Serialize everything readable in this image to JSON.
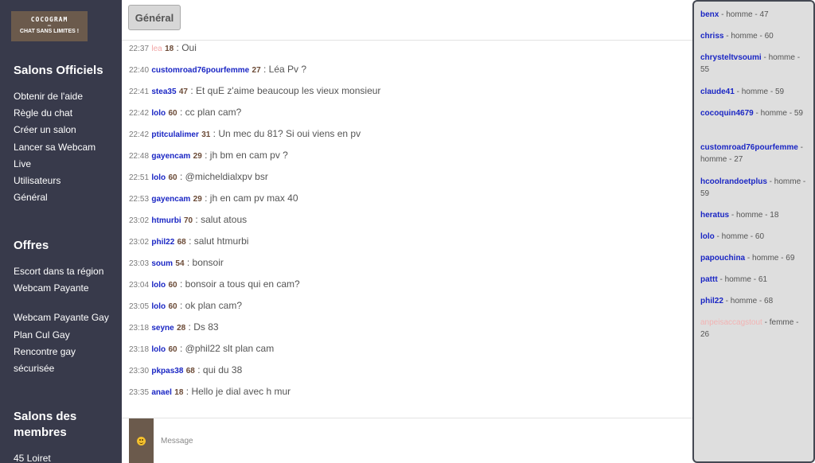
{
  "logo": {
    "line1": "COCOGRAM",
    "line2": "–",
    "line3": "CHAT SANS LIMITES !"
  },
  "sidebar": {
    "sections": [
      {
        "title": "Salons Officiels",
        "items": [
          "Obtenir de l'aide",
          "Règle du chat",
          "Créer un salon",
          "Lancer sa Webcam",
          "Live",
          "Utilisateurs",
          "Général"
        ]
      },
      {
        "title": "Offres",
        "items": [
          "Escort dans ta région",
          "Webcam Payante",
          "Webcam Payante Gay",
          "Plan Cul Gay",
          "Rencontre gay",
          "sécurisée"
        ]
      },
      {
        "title_line1": "Salons des",
        "title_line2": "membres",
        "items": [
          "45 Loiret"
        ]
      }
    ]
  },
  "topbar": {
    "active_tab": "Général"
  },
  "messages": [
    {
      "time": "22:37",
      "user": "lea",
      "age": "18",
      "text": "Oui",
      "gender": "female"
    },
    {
      "time": "22:40",
      "user": "customroad76pourfemme",
      "age": "27",
      "text": "Léa Pv ?",
      "gender": "male"
    },
    {
      "time": "22:41",
      "user": "stea35",
      "age": "47",
      "text": "Et quE z'aime beaucoup les vieux monsieur",
      "gender": "male"
    },
    {
      "time": "22:42",
      "user": "lolo",
      "age": "60",
      "text": "cc plan cam?",
      "gender": "male"
    },
    {
      "time": "22:42",
      "user": "ptitculalimer",
      "age": "31",
      "text": "Un mec du 81? Si oui viens en pv",
      "gender": "male"
    },
    {
      "time": "22:48",
      "user": "gayencam",
      "age": "29",
      "text": "jh bm en cam pv ?",
      "gender": "male"
    },
    {
      "time": "22:51",
      "user": "lolo",
      "age": "60",
      "text": "@micheldialxpv bsr",
      "gender": "male"
    },
    {
      "time": "22:53",
      "user": "gayencam",
      "age": "29",
      "text": "jh en cam pv max 40",
      "gender": "male"
    },
    {
      "time": "23:02",
      "user": "htmurbi",
      "age": "70",
      "text": "salut atous",
      "gender": "male"
    },
    {
      "time": "23:02",
      "user": "phil22",
      "age": "68",
      "text": "salut htmurbi",
      "gender": "male"
    },
    {
      "time": "23:03",
      "user": "soum",
      "age": "54",
      "text": "bonsoir",
      "gender": "male"
    },
    {
      "time": "23:04",
      "user": "lolo",
      "age": "60",
      "text": "bonsoir a tous qui en cam?",
      "gender": "male"
    },
    {
      "time": "23:05",
      "user": "lolo",
      "age": "60",
      "text": "ok plan cam?",
      "gender": "male"
    },
    {
      "time": "23:18",
      "user": "seyne",
      "age": "28",
      "text": "Ds 83",
      "gender": "male"
    },
    {
      "time": "23:18",
      "user": "lolo",
      "age": "60",
      "text": "@phil22 slt plan cam",
      "gender": "male"
    },
    {
      "time": "23:30",
      "user": "pkpas38",
      "age": "68",
      "text": "qui du 38",
      "gender": "male"
    },
    {
      "time": "23:35",
      "user": "anael",
      "age": "18",
      "text": "Hello je dial avec h mur",
      "gender": "male"
    }
  ],
  "compose": {
    "placeholder": "Message",
    "emoji_icon": "smiley-emoji-icon"
  },
  "users": [
    {
      "name": "benx",
      "gender": "homme",
      "age": "47"
    },
    {
      "name": "chriss",
      "gender": "homme",
      "age": "60"
    },
    {
      "name": "chrysteltvsoumi",
      "gender": "homme",
      "age": "55"
    },
    {
      "name": "claude41",
      "gender": "homme",
      "age": "59"
    },
    {
      "name": "cocoquin4679",
      "gender": "homme",
      "age": "59"
    },
    {
      "name": "customroad76pourfemme",
      "gender": "homme",
      "age": "27"
    },
    {
      "name": "hcoolrandoetplus",
      "gender": "homme",
      "age": "59"
    },
    {
      "name": "heratus",
      "gender": "homme",
      "age": "18"
    },
    {
      "name": "lolo",
      "gender": "homme",
      "age": "60"
    },
    {
      "name": "papouchina",
      "gender": "homme",
      "age": "69"
    },
    {
      "name": "pattt",
      "gender": "homme",
      "age": "61"
    },
    {
      "name": "phil22",
      "gender": "homme",
      "age": "68"
    },
    {
      "name": "anpeisaccagstout",
      "gender": "femme",
      "age": "26"
    }
  ],
  "colors": {
    "sidebar_bg": "#383a4b",
    "brand": "#6b5a4c",
    "username": "#1a26c4",
    "female_username": "#f2a6a6",
    "userlist_bg": "#dedede"
  }
}
